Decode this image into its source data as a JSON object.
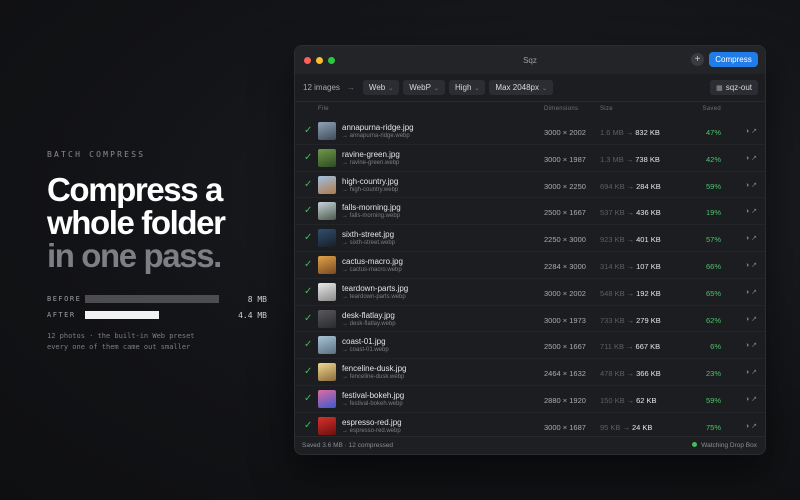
{
  "hero": {
    "eyebrow": "BATCH COMPRESS",
    "headline_1": "Compress a",
    "headline_2": "whole folder",
    "headline_3": "in one pass.",
    "before_label": "BEFORE",
    "before_value": "8 MB",
    "after_label": "AFTER",
    "after_value": "4.4 MB",
    "after_fraction": 0.55,
    "footnote_1": "12 photos · the built-in Web preset",
    "footnote_2": "every one of them came out smaller"
  },
  "window": {
    "title": "Sqz",
    "add_label": "+",
    "compress_label": "Compress",
    "traffic_colors": [
      "#ff5f57",
      "#febc2e",
      "#28c840"
    ]
  },
  "toolbar": {
    "count": "12 images",
    "arrow": "→",
    "chips": [
      "Web",
      "WebP",
      "High",
      "Max 2048px"
    ],
    "output": "sqz-out"
  },
  "columns": {
    "file": "File",
    "dimensions": "Dimensions",
    "size": "Size",
    "saved": "Saved"
  },
  "rows": [
    {
      "name": "annapurna-ridge.jpg",
      "out": "→ annapurna-ridge.webp",
      "dims": "3000 × 2002",
      "old": "1.6 MB",
      "new": "832 KB",
      "saved": "47%",
      "thumb": [
        "#8fa3b8",
        "#3f4b58"
      ]
    },
    {
      "name": "ravine-green.jpg",
      "out": "→ ravine-green.webp",
      "dims": "3000 × 1987",
      "old": "1.3 MB",
      "new": "738 KB",
      "saved": "42%",
      "thumb": [
        "#6f9a4a",
        "#2f4a22"
      ]
    },
    {
      "name": "high-country.jpg",
      "out": "→ high-country.webp",
      "dims": "3000 × 2250",
      "old": "694 KB",
      "new": "284 KB",
      "saved": "59%",
      "thumb": [
        "#9fc0e0",
        "#b07a4a"
      ]
    },
    {
      "name": "falls-morning.jpg",
      "out": "→ falls-morning.webp",
      "dims": "2500 × 1667",
      "old": "537 KB",
      "new": "436 KB",
      "saved": "19%",
      "thumb": [
        "#c9d2d8",
        "#4a5a4e"
      ]
    },
    {
      "name": "sixth-street.jpg",
      "out": "→ sixth-street.webp",
      "dims": "2250 × 3000",
      "old": "923 KB",
      "new": "401 KB",
      "saved": "57%",
      "thumb": [
        "#2f4f6e",
        "#1a1e26"
      ]
    },
    {
      "name": "cactus-macro.jpg",
      "out": "→ cactus-macro.webp",
      "dims": "2284 × 3000",
      "old": "314 KB",
      "new": "107 KB",
      "saved": "66%",
      "thumb": [
        "#e0a24a",
        "#7a4a22"
      ]
    },
    {
      "name": "teardown-parts.jpg",
      "out": "→ teardown-parts.webp",
      "dims": "3000 × 2002",
      "old": "548 KB",
      "new": "192 KB",
      "saved": "65%",
      "thumb": [
        "#e8e8e8",
        "#8a8a8a"
      ]
    },
    {
      "name": "desk-flatlay.jpg",
      "out": "→ desk-flatlay.webp",
      "dims": "3000 × 1973",
      "old": "733 KB",
      "new": "279 KB",
      "saved": "62%",
      "thumb": [
        "#5a5a5e",
        "#2a2a2e"
      ]
    },
    {
      "name": "coast-01.jpg",
      "out": "→ coast-01.webp",
      "dims": "2500 × 1667",
      "old": "711 KB",
      "new": "667 KB",
      "saved": "6%",
      "thumb": [
        "#a9c4d8",
        "#5a7080"
      ]
    },
    {
      "name": "fenceline-dusk.jpg",
      "out": "→ fenceline-dusk.webp",
      "dims": "2464 × 1632",
      "old": "478 KB",
      "new": "366 KB",
      "saved": "23%",
      "thumb": [
        "#f0d890",
        "#8a6a3a"
      ]
    },
    {
      "name": "festival-bokeh.jpg",
      "out": "→ festival-bokeh.webp",
      "dims": "2880 × 1920",
      "old": "150 KB",
      "new": "62 KB",
      "saved": "59%",
      "thumb": [
        "#e06aa0",
        "#3a5ad0"
      ]
    },
    {
      "name": "espresso-red.jpg",
      "out": "→ espresso-red.webp",
      "dims": "3000 × 1687",
      "old": "95 KB",
      "new": "24 KB",
      "saved": "75%",
      "thumb": [
        "#d8302a",
        "#6a1010"
      ]
    }
  ],
  "status": {
    "summary": "Saved 3.6 MB · 12 compressed",
    "watching": "Watching Drop Box"
  },
  "icons": {
    "check": "✓",
    "compare": "◑",
    "reveal": "↗",
    "folder": "▦",
    "caret": "⌄"
  }
}
